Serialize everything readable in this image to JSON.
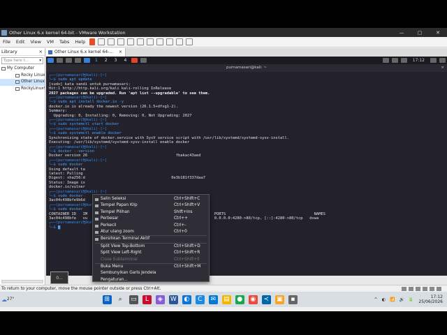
{
  "window": {
    "title": "Other Linux 6.x kernel 64-bit - VMware Workstation",
    "controls": [
      "—",
      "▢",
      "✕"
    ]
  },
  "menu": [
    "File",
    "Edit",
    "View",
    "VM",
    "Tabs",
    "Help"
  ],
  "library": {
    "title": "Library",
    "close": "×",
    "search_placeholder": "Type here t...",
    "items": [
      {
        "label": "My Computer",
        "selected": false,
        "indent": 0
      },
      {
        "label": "Rocky Linux",
        "selected": false,
        "indent": 1
      },
      {
        "label": "Other Linux",
        "selected": true,
        "indent": 1
      },
      {
        "label": "RockyLinux9",
        "selected": false,
        "indent": 1
      }
    ]
  },
  "vm_tab": {
    "label": "Other Linux 6.x kernel 64-...",
    "close": "×"
  },
  "guest_panel": {
    "workspaces": [
      "1",
      "2",
      "3",
      "4"
    ],
    "active_workspace": "1",
    "clock": "17:12"
  },
  "terminal": {
    "title": "purnamasari@kali: ~",
    "close": "×",
    "lines": [
      {
        "prompt": "┌──(purnamasari㉿kali)-[~]",
        "cmd": ""
      },
      {
        "prompt": "└─$ ",
        "cmd": "sudo apt update"
      },
      {
        "text": "[sudo] kata sandi untuk purnamasari:"
      },
      {
        "text": "Hit:1 http://http.kali.org/kali kali-rolling InRelease"
      },
      {
        "text": "2027 packages can be upgraded. Run 'apt list --upgradable' to see them.",
        "bold": true
      },
      {
        "text": ""
      },
      {
        "prompt": "┌──(purnamasari㉿kali)-[~]",
        "cmd": ""
      },
      {
        "prompt": "└─$ ",
        "cmd": "sudo apt install docker.io -y"
      },
      {
        "text": "docker.io is already the newest version (26.1.5+dfsg1-2)."
      },
      {
        "text": "Summary:"
      },
      {
        "text": "  Upgrading: 0, Installing: 0, Removing: 0, Not Upgrading: 2027"
      },
      {
        "text": ""
      },
      {
        "prompt": "┌──(purnamasari㉿kali)-[~]",
        "cmd": ""
      },
      {
        "prompt": "└─$ ",
        "cmd": "sudo systemctl start docker"
      },
      {
        "text": ""
      },
      {
        "prompt": "┌──(purnamasari㉿kali)-[~]",
        "cmd": ""
      },
      {
        "prompt": "└─$ ",
        "cmd": "sudo systemctl enable docker"
      },
      {
        "text": "Synchronizing state of docker.service with SysV service script with /usr/lib/systemd/systemd-sysv-install."
      },
      {
        "text": "Executing: /usr/lib/systemd/systemd-sysv-install enable docker"
      },
      {
        "text": ""
      },
      {
        "prompt": "┌──(purnamasari㉿kali)-[~]",
        "cmd": ""
      },
      {
        "prompt": "└─$ ",
        "cmd": "docker --version"
      },
      {
        "text": "Docker version 26                                       fbakac43aed"
      },
      {
        "text": ""
      },
      {
        "prompt": "┌──(purnamasari㉿kali)-[~]",
        "cmd": ""
      },
      {
        "prompt": "└─$ ",
        "cmd": "sudo docker"
      },
      {
        "text": "Using default ta"
      },
      {
        "text": "latest: Pulling"
      },
      {
        "text": "Digest: sha256:d                                      0e3b181f337daa7"
      },
      {
        "text": "Status: Image is"
      },
      {
        "text": "docker.io/vulner"
      },
      {
        "text": ""
      },
      {
        "prompt": "┌──(purnamasari㉿kali)-[~]",
        "cmd": ""
      },
      {
        "prompt": "└─$ ",
        "cmd": "sudo docker"
      },
      {
        "text": "3ac04c498bfe9b6d                                       wa"
      },
      {
        "text": ""
      },
      {
        "prompt": "┌──(purnamasari㉿kali)-[~]",
        "cmd": ""
      },
      {
        "prompt": "└─$ ",
        "cmd": "sudo docker"
      },
      {
        "text": "CONTAINER ID   IM                                        STATUS          PORTS                                       NAMES"
      },
      {
        "text": "3ac04c498bfe   vu                                        Up 10 seconds   0.0.0.0:4280->80/tcp, [::]:4280->80/tcp   dvwa"
      },
      {
        "text": ""
      },
      {
        "prompt": "┌──(purnamasari㉿kali)-[~]",
        "cmd": ""
      },
      {
        "prompt": "└─$ ",
        "cmd": "█"
      }
    ]
  },
  "context_menu": {
    "items": [
      {
        "label": "Salin Seleksi",
        "shortcut": "Ctrl+Shift+C",
        "disabled": false,
        "icon": true
      },
      {
        "label": "Tempel Papan Klip",
        "shortcut": "Ctrl+Shift+V",
        "disabled": false,
        "icon": true
      },
      {
        "label": "Tempel Pilihan",
        "shortcut": "Shift+Ins",
        "disabled": false,
        "icon": true
      },
      {
        "label": "Perbesar",
        "shortcut": "Ctrl++",
        "disabled": false,
        "icon": true
      },
      {
        "label": "Perkecil",
        "shortcut": "Ctrl+-",
        "disabled": false,
        "icon": true
      },
      {
        "label": "Atur ulang zoom",
        "shortcut": "Ctrl+0",
        "disabled": false,
        "icon": true
      },
      {
        "sep": true
      },
      {
        "label": "Bersihkan Terminal Aktif",
        "shortcut": "",
        "disabled": false,
        "icon": true
      },
      {
        "sep": true
      },
      {
        "label": "Split View Top-Bottom",
        "shortcut": "Ctrl+Shift+D",
        "disabled": false,
        "icon": false
      },
      {
        "label": "Split View Left-Right",
        "shortcut": "Ctrl+Shift+R",
        "disabled": false,
        "icon": false
      },
      {
        "label": "Close Subterminal",
        "shortcut": "Ctrl+Shift+E",
        "disabled": true,
        "icon": false
      },
      {
        "sep": true
      },
      {
        "label": "Buka Menu",
        "shortcut": "Ctrl+Shift+M",
        "disabled": false,
        "icon": false
      },
      {
        "label": "Sembunyikan Garis Jendela",
        "shortcut": "",
        "disabled": false,
        "icon": false
      },
      {
        "label": "Pengaturan...",
        "shortcut": "",
        "disabled": false,
        "icon": false
      }
    ]
  },
  "vm_thumb": "0...",
  "status_text": "To return to your computer, move the mouse pointer outside or press Ctrl+Alt.",
  "taskbar": {
    "weather": "27°",
    "clock_time": "17:12",
    "clock_date": "25/06/2026",
    "tray_symbols": [
      "^",
      "◐",
      "📶",
      "🔊",
      "🔋"
    ]
  }
}
